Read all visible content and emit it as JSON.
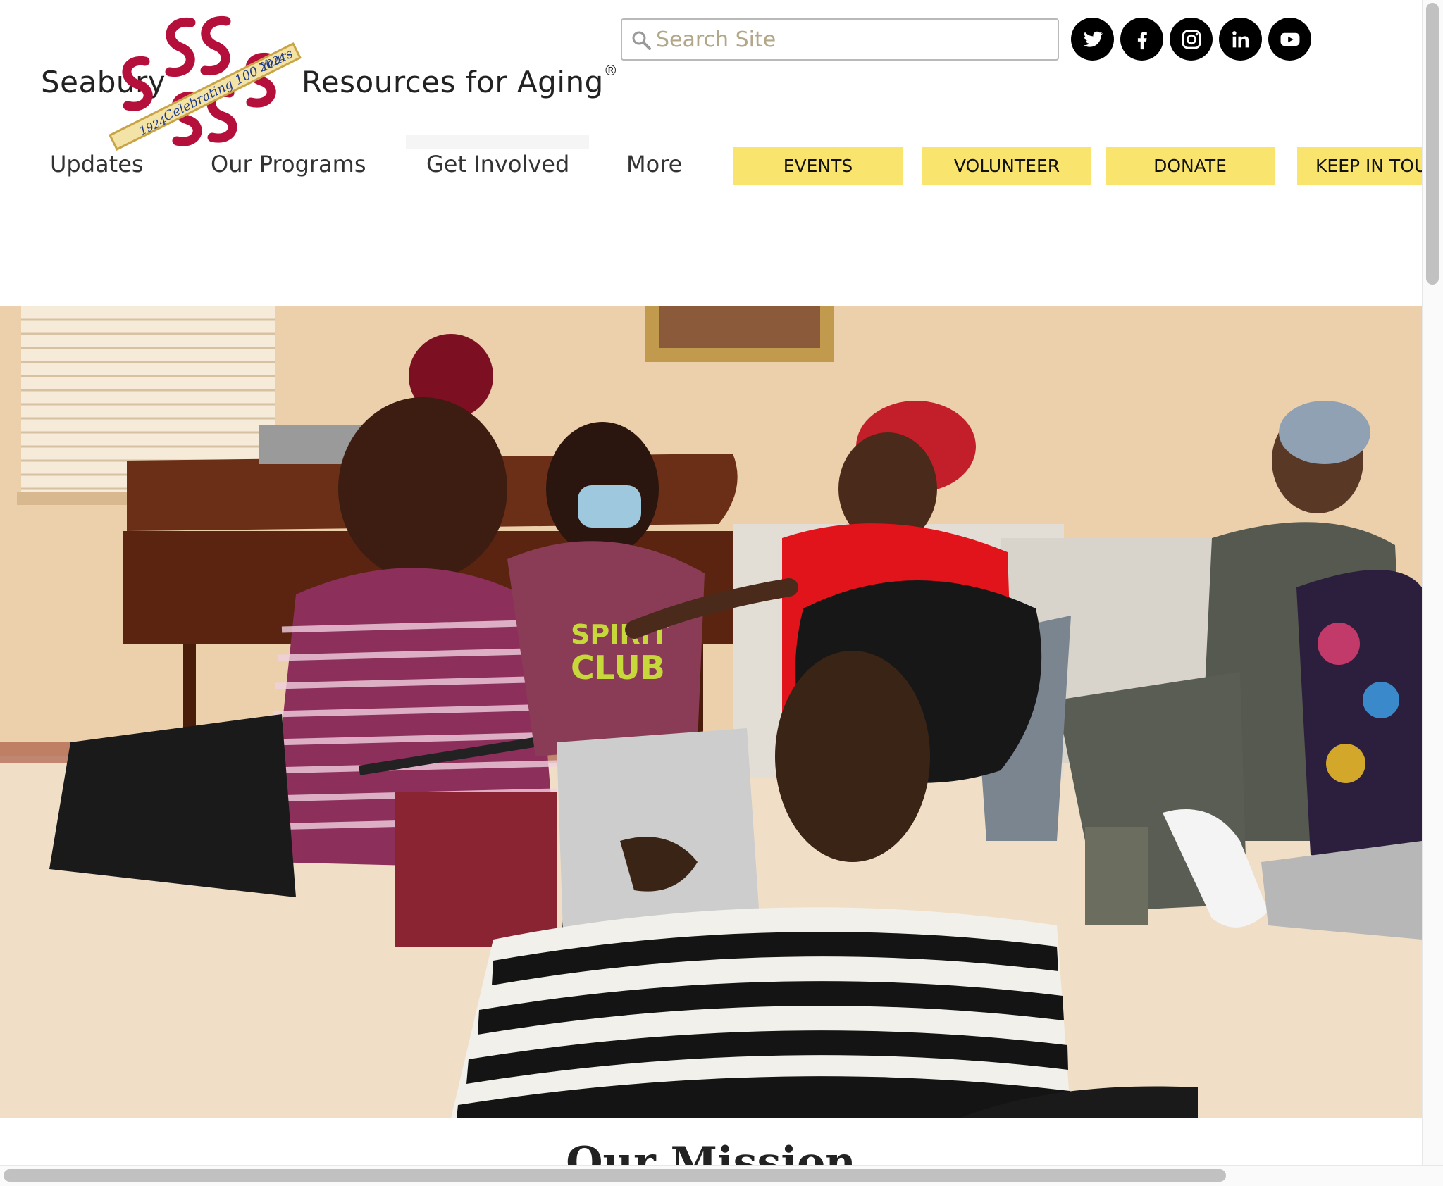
{
  "logo": {
    "left_text": "Seabury",
    "right_text": "Resources for Aging",
    "registered_mark": "®",
    "banner_text": "Celebrating 100 Years",
    "year_start": "1924",
    "year_end": "2024"
  },
  "search": {
    "placeholder": "Search Site",
    "icon": "search-icon"
  },
  "social": [
    {
      "name": "twitter",
      "icon": "twitter-icon"
    },
    {
      "name": "facebook",
      "icon": "facebook-icon"
    },
    {
      "name": "instagram",
      "icon": "instagram-icon"
    },
    {
      "name": "linkedin",
      "icon": "linkedin-icon"
    },
    {
      "name": "youtube",
      "icon": "youtube-icon"
    }
  ],
  "nav": {
    "items": [
      {
        "label": "Updates"
      },
      {
        "label": "Our Programs"
      },
      {
        "label": "Get Involved"
      },
      {
        "label": "More"
      }
    ]
  },
  "cta": {
    "buttons": [
      {
        "label": "EVENTS"
      },
      {
        "label": "VOLUNTEER"
      },
      {
        "label": "DONATE"
      },
      {
        "label": "KEEP IN TOUCH"
      }
    ]
  },
  "hero": {
    "shirt_text_1": "SPIRIT",
    "shirt_text_2": "CLUB"
  },
  "mission": {
    "title": "Our Mission"
  },
  "colors": {
    "cta_background": "#f9e56e",
    "logo_crimson": "#b5103c",
    "logo_banner": "#f3e3a6",
    "text": "#333333"
  }
}
